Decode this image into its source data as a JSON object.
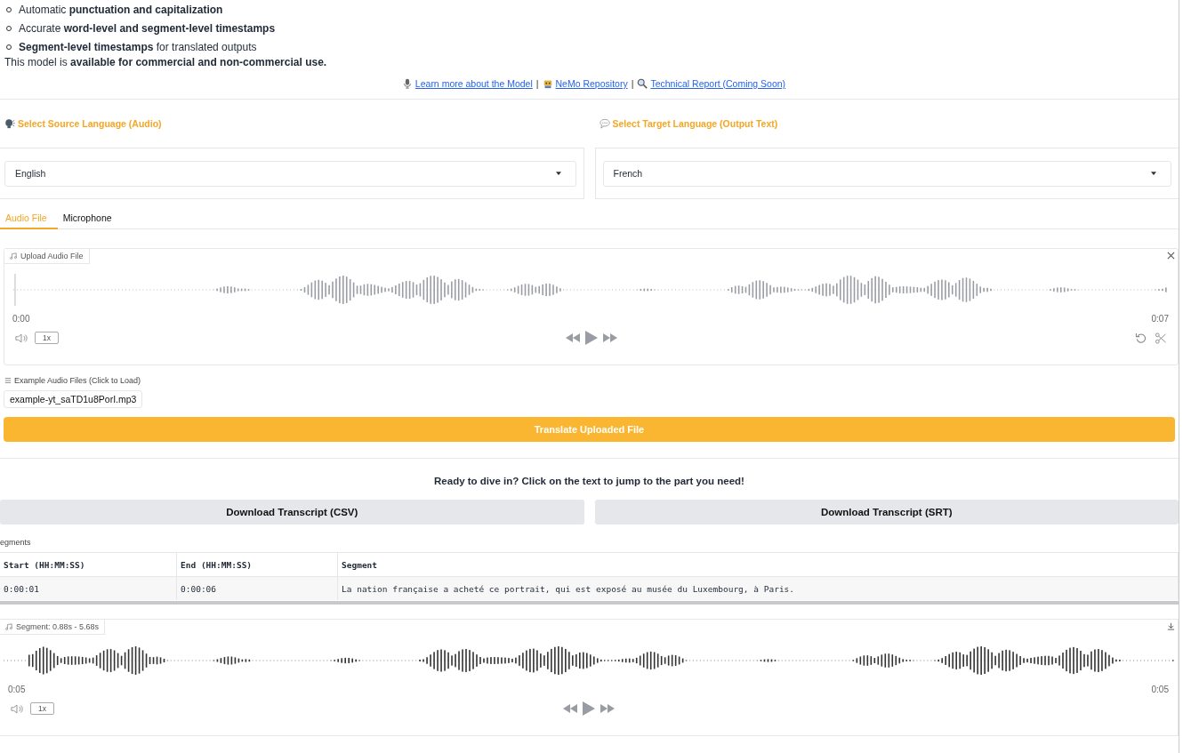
{
  "features": [
    "Automatic **punctuation and capitalization**",
    "Accurate **word-level and segment-level timestamps**",
    "**Segment-level timestamps** for translated outputs"
  ],
  "usage_note": "This model is **available for commercial and non-commercial use.**",
  "links": [
    {
      "text": "Learn more about the Model"
    },
    {
      "text": "NeMo Repository"
    },
    {
      "text": "Technical Report (Coming Soon)"
    }
  ],
  "link_separators": [
    "|",
    "|"
  ],
  "source_language": {
    "label": "Select Source Language (Audio)",
    "value": "English"
  },
  "target_language": {
    "label": "Select Target Language (Output Text)",
    "value": "French"
  },
  "tabs": [
    {
      "label": "Audio File",
      "selected": true
    },
    {
      "label": "Microphone",
      "selected": false
    }
  ],
  "upload_player": {
    "label": "Upload Audio File",
    "start_time": "0:00",
    "end_time": "0:07",
    "speed": "1x"
  },
  "examples": {
    "label": "Example Audio Files (Click to Load)",
    "files": [
      "example-yt_saTD1u8PorI.mp3"
    ]
  },
  "translate_button": "Translate Uploaded File",
  "prompt": "Ready to dive in? Click on the text to jump to the part you need!",
  "download_buttons": [
    "Download Transcript (CSV)",
    "Download Transcript (SRT)"
  ],
  "segments": {
    "label": "egments",
    "columns": [
      "Start (HH:MM:SS)",
      "End (HH:MM:SS)",
      "Segment"
    ],
    "rows": [
      [
        "0:00:01",
        "0:00:06",
        "La nation française a acheté ce portrait, qui est exposé au musée du Luxembourg, à Paris."
      ]
    ]
  },
  "segment_player": {
    "label": "Segment: 0.88s - 5.68s",
    "start_time": "0:05",
    "end_time": "0:05",
    "speed": "1x"
  }
}
